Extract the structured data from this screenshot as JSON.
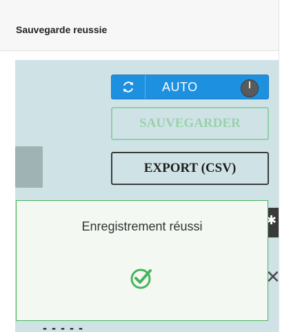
{
  "card": {
    "title": "Sauvegarde reussie"
  },
  "toolbar": {
    "auto_label": "AUTO",
    "save_label": "SAUVEGARDER",
    "export_label": "EXPORT (CSV)"
  },
  "partial": {
    "dark_strip_glyph": "✱",
    "close_glyph": "✕",
    "bottom_text": "- - - - -"
  },
  "toast": {
    "message": "Enregistrement réussi",
    "icon": "check-circle-icon"
  },
  "colors": {
    "primary": "#1e90e0",
    "success": "#49b35a",
    "save_disabled": "#8ecfa5",
    "panel_bg": "#cfe3e7"
  }
}
